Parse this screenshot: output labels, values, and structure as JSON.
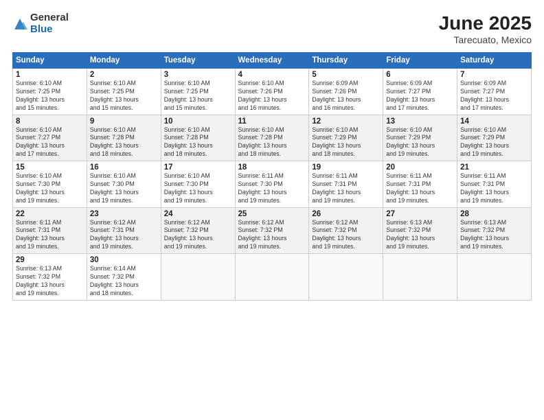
{
  "logo": {
    "general": "General",
    "blue": "Blue"
  },
  "header": {
    "month": "June 2025",
    "location": "Tarecuato, Mexico"
  },
  "weekdays": [
    "Sunday",
    "Monday",
    "Tuesday",
    "Wednesday",
    "Thursday",
    "Friday",
    "Saturday"
  ],
  "weeks": [
    [
      {
        "day": "1",
        "info": "Sunrise: 6:10 AM\nSunset: 7:25 PM\nDaylight: 13 hours\nand 15 minutes."
      },
      {
        "day": "2",
        "info": "Sunrise: 6:10 AM\nSunset: 7:25 PM\nDaylight: 13 hours\nand 15 minutes."
      },
      {
        "day": "3",
        "info": "Sunrise: 6:10 AM\nSunset: 7:25 PM\nDaylight: 13 hours\nand 15 minutes."
      },
      {
        "day": "4",
        "info": "Sunrise: 6:10 AM\nSunset: 7:26 PM\nDaylight: 13 hours\nand 16 minutes."
      },
      {
        "day": "5",
        "info": "Sunrise: 6:09 AM\nSunset: 7:26 PM\nDaylight: 13 hours\nand 16 minutes."
      },
      {
        "day": "6",
        "info": "Sunrise: 6:09 AM\nSunset: 7:27 PM\nDaylight: 13 hours\nand 17 minutes."
      },
      {
        "day": "7",
        "info": "Sunrise: 6:09 AM\nSunset: 7:27 PM\nDaylight: 13 hours\nand 17 minutes."
      }
    ],
    [
      {
        "day": "8",
        "info": "Sunrise: 6:10 AM\nSunset: 7:27 PM\nDaylight: 13 hours\nand 17 minutes."
      },
      {
        "day": "9",
        "info": "Sunrise: 6:10 AM\nSunset: 7:28 PM\nDaylight: 13 hours\nand 18 minutes."
      },
      {
        "day": "10",
        "info": "Sunrise: 6:10 AM\nSunset: 7:28 PM\nDaylight: 13 hours\nand 18 minutes."
      },
      {
        "day": "11",
        "info": "Sunrise: 6:10 AM\nSunset: 7:28 PM\nDaylight: 13 hours\nand 18 minutes."
      },
      {
        "day": "12",
        "info": "Sunrise: 6:10 AM\nSunset: 7:29 PM\nDaylight: 13 hours\nand 18 minutes."
      },
      {
        "day": "13",
        "info": "Sunrise: 6:10 AM\nSunset: 7:29 PM\nDaylight: 13 hours\nand 19 minutes."
      },
      {
        "day": "14",
        "info": "Sunrise: 6:10 AM\nSunset: 7:29 PM\nDaylight: 13 hours\nand 19 minutes."
      }
    ],
    [
      {
        "day": "15",
        "info": "Sunrise: 6:10 AM\nSunset: 7:30 PM\nDaylight: 13 hours\nand 19 minutes."
      },
      {
        "day": "16",
        "info": "Sunrise: 6:10 AM\nSunset: 7:30 PM\nDaylight: 13 hours\nand 19 minutes."
      },
      {
        "day": "17",
        "info": "Sunrise: 6:10 AM\nSunset: 7:30 PM\nDaylight: 13 hours\nand 19 minutes."
      },
      {
        "day": "18",
        "info": "Sunrise: 6:11 AM\nSunset: 7:30 PM\nDaylight: 13 hours\nand 19 minutes."
      },
      {
        "day": "19",
        "info": "Sunrise: 6:11 AM\nSunset: 7:31 PM\nDaylight: 13 hours\nand 19 minutes."
      },
      {
        "day": "20",
        "info": "Sunrise: 6:11 AM\nSunset: 7:31 PM\nDaylight: 13 hours\nand 19 minutes."
      },
      {
        "day": "21",
        "info": "Sunrise: 6:11 AM\nSunset: 7:31 PM\nDaylight: 13 hours\nand 19 minutes."
      }
    ],
    [
      {
        "day": "22",
        "info": "Sunrise: 6:11 AM\nSunset: 7:31 PM\nDaylight: 13 hours\nand 19 minutes."
      },
      {
        "day": "23",
        "info": "Sunrise: 6:12 AM\nSunset: 7:31 PM\nDaylight: 13 hours\nand 19 minutes."
      },
      {
        "day": "24",
        "info": "Sunrise: 6:12 AM\nSunset: 7:32 PM\nDaylight: 13 hours\nand 19 minutes."
      },
      {
        "day": "25",
        "info": "Sunrise: 6:12 AM\nSunset: 7:32 PM\nDaylight: 13 hours\nand 19 minutes."
      },
      {
        "day": "26",
        "info": "Sunrise: 6:12 AM\nSunset: 7:32 PM\nDaylight: 13 hours\nand 19 minutes."
      },
      {
        "day": "27",
        "info": "Sunrise: 6:13 AM\nSunset: 7:32 PM\nDaylight: 13 hours\nand 19 minutes."
      },
      {
        "day": "28",
        "info": "Sunrise: 6:13 AM\nSunset: 7:32 PM\nDaylight: 13 hours\nand 19 minutes."
      }
    ],
    [
      {
        "day": "29",
        "info": "Sunrise: 6:13 AM\nSunset: 7:32 PM\nDaylight: 13 hours\nand 19 minutes."
      },
      {
        "day": "30",
        "info": "Sunrise: 6:14 AM\nSunset: 7:32 PM\nDaylight: 13 hours\nand 18 minutes."
      },
      {
        "day": "",
        "info": ""
      },
      {
        "day": "",
        "info": ""
      },
      {
        "day": "",
        "info": ""
      },
      {
        "day": "",
        "info": ""
      },
      {
        "day": "",
        "info": ""
      }
    ]
  ]
}
